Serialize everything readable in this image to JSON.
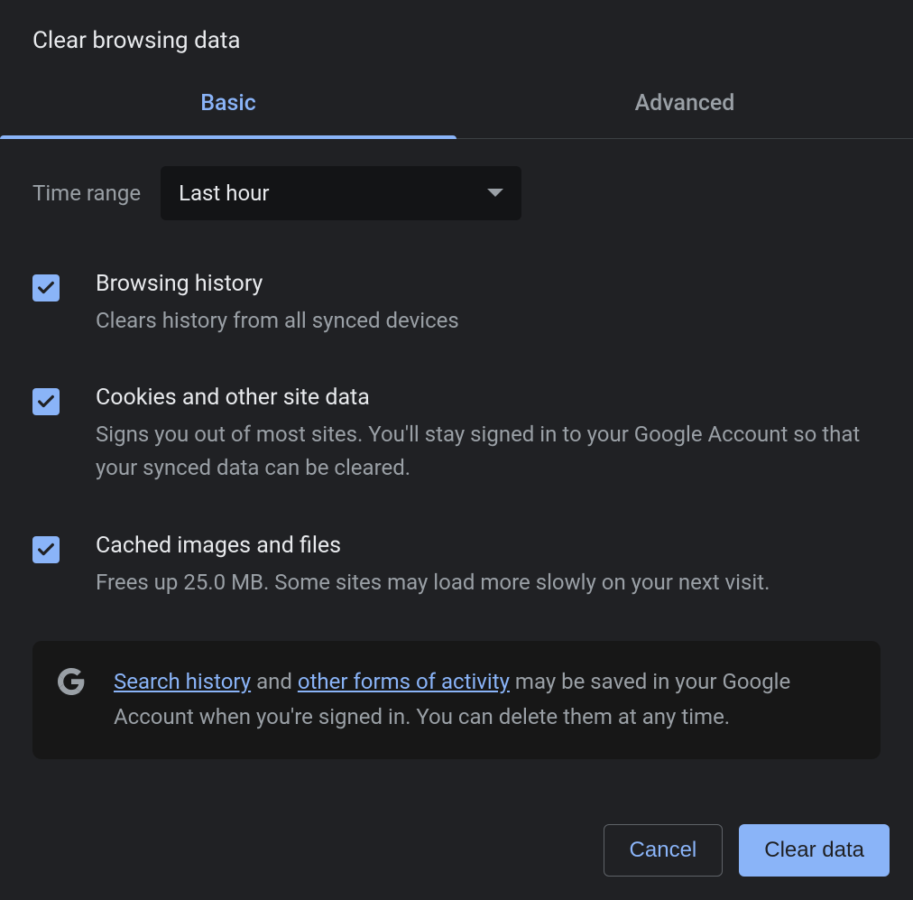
{
  "dialog": {
    "title": "Clear browsing data"
  },
  "tabs": {
    "basic": "Basic",
    "advanced": "Advanced"
  },
  "time_range": {
    "label": "Time range",
    "value": "Last hour"
  },
  "options": [
    {
      "title": "Browsing history",
      "desc": "Clears history from all synced devices"
    },
    {
      "title": "Cookies and other site data",
      "desc": "Signs you out of most sites. You'll stay signed in to your Google Account so that your synced data can be cleared."
    },
    {
      "title": "Cached images and files",
      "desc": "Frees up 25.0 MB. Some sites may load more slowly on your next visit."
    }
  ],
  "info": {
    "link_search_history": "Search history",
    "text_and": " and ",
    "link_other_activity": "other forms of activity",
    "text_rest": " may be saved in your Google Account when you're signed in. You can delete them at any time."
  },
  "footer": {
    "cancel": "Cancel",
    "clear": "Clear data"
  }
}
